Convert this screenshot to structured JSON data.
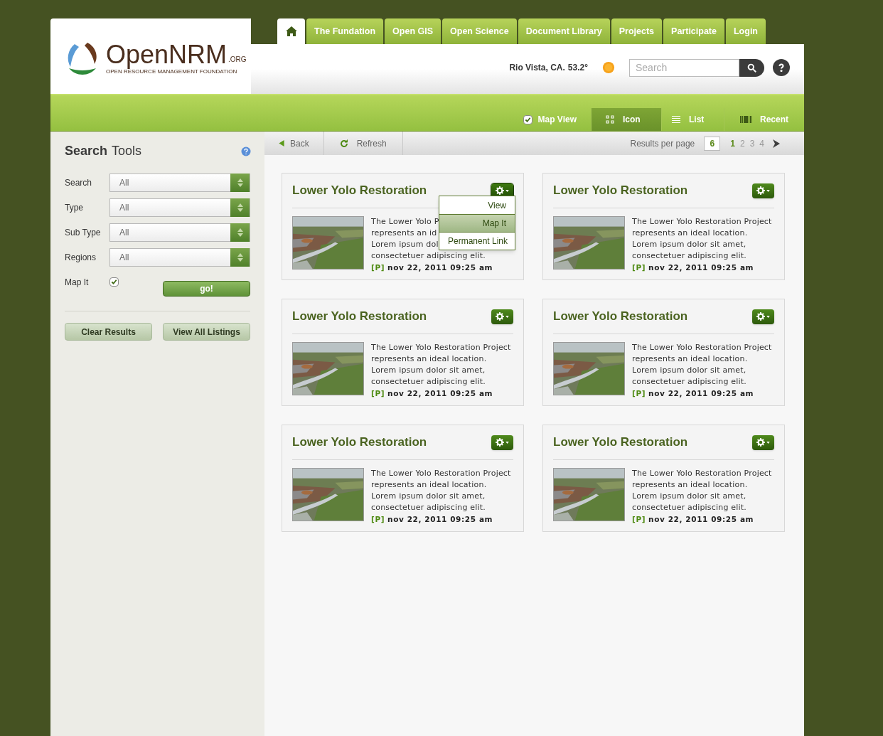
{
  "logo": {
    "name": "OpenNRM",
    "suffix": ".ORG",
    "tagline": "OPEN RESOURCE MANAGEMENT FOUNDATION"
  },
  "nav": [
    {
      "kind": "home",
      "selected": true
    },
    {
      "kind": "text",
      "label": "The Fundation",
      "selected": false
    },
    {
      "kind": "text",
      "label": "Open GIS",
      "selected": false
    },
    {
      "kind": "text",
      "label": "Open Science",
      "selected": false
    },
    {
      "kind": "text",
      "label": "Document Library",
      "selected": false
    },
    {
      "kind": "text",
      "label": "Projects",
      "selected": false
    },
    {
      "kind": "text",
      "label": "Participate",
      "selected": false
    },
    {
      "kind": "text",
      "label": "Login",
      "selected": false
    }
  ],
  "weather": {
    "location": "Rio Vista, CA.",
    "temperature": "53.2°"
  },
  "search": {
    "placeholder": "Search"
  },
  "view_bar": {
    "map_view": {
      "label": "Map View",
      "checked": true
    },
    "views": [
      {
        "kind": "grid",
        "label": "Icon",
        "selected": true
      },
      {
        "kind": "list",
        "label": "List",
        "selected": false
      },
      {
        "kind": "film",
        "label": "Recent",
        "selected": false
      }
    ]
  },
  "sidebar": {
    "title_bold": "Search",
    "title_rest": "Tools",
    "filters": [
      {
        "label": "Search",
        "value": "All"
      },
      {
        "label": "Type",
        "value": "All"
      },
      {
        "label": "Sub Type",
        "value": "All"
      },
      {
        "label": "Regions",
        "value": "All"
      }
    ],
    "map_it": {
      "label": "Map It",
      "checked": true
    },
    "go_button": "go!",
    "buttons": [
      "Clear Results",
      "View All Listings"
    ]
  },
  "toolbar": {
    "back": "Back",
    "refresh": "Refresh",
    "results_label": "Results per page",
    "results_value": "6",
    "pages": [
      {
        "label": "1",
        "selected": true
      },
      {
        "label": "2",
        "selected": false
      },
      {
        "label": "3",
        "selected": false
      },
      {
        "label": "4",
        "selected": false
      }
    ]
  },
  "cards": [
    {
      "title": "Lower Yolo Restoration",
      "lines": [
        "The Lower Yolo P",
        "represents an id",
        "Lorem ipsum dol",
        "consectetuer adipiscing elit."
      ],
      "tag": "[P]",
      "date": "nov 22, 2011 09:25 am",
      "menu_open": true,
      "menu": [
        {
          "label": "View",
          "selected": false
        },
        {
          "label": "Map It",
          "selected": true
        },
        {
          "label": "Permanent Link",
          "selected": false
        }
      ]
    },
    {
      "title": "Lower Yolo Restoration",
      "lines": [
        "The Lower Yolo Restoration Project",
        "represents an ideal location.",
        "Lorem ipsum dolor sit amet,",
        "consectetuer adipiscing elit."
      ],
      "tag": "[P]",
      "date": "nov 22, 2011 09:25 am",
      "menu_open": false
    },
    {
      "title": "Lower Yolo Restoration",
      "lines": [
        "The Lower Yolo Restoration Project",
        "represents an ideal location.",
        "Lorem ipsum dolor sit amet,",
        "consectetuer adipiscing elit."
      ],
      "tag": "[P]",
      "date": "nov 22, 2011 09:25 am",
      "menu_open": false
    },
    {
      "title": "Lower Yolo Restoration",
      "lines": [
        "The Lower Yolo Restoration Project",
        "represents an ideal location.",
        "Lorem ipsum dolor sit amet,",
        "consectetuer adipiscing elit."
      ],
      "tag": "[P]",
      "date": "nov 22, 2011 09:25 am",
      "menu_open": false
    },
    {
      "title": "Lower Yolo Restoration",
      "lines": [
        "The Lower Yolo Restoration Project",
        "represents an ideal location.",
        "Lorem ipsum dolor sit amet,",
        "consectetuer adipiscing elit."
      ],
      "tag": "[P]",
      "date": "nov 22, 2011 09:25 am",
      "menu_open": false
    },
    {
      "title": "Lower Yolo Restoration",
      "lines": [
        "The Lower Yolo Restoration Project",
        "represents an ideal location.",
        "Lorem ipsum dolor sit amet,",
        "consectetuer adipiscing elit."
      ],
      "tag": "[P]",
      "date": "nov 22, 2011 09:25 am",
      "menu_open": false
    }
  ]
}
